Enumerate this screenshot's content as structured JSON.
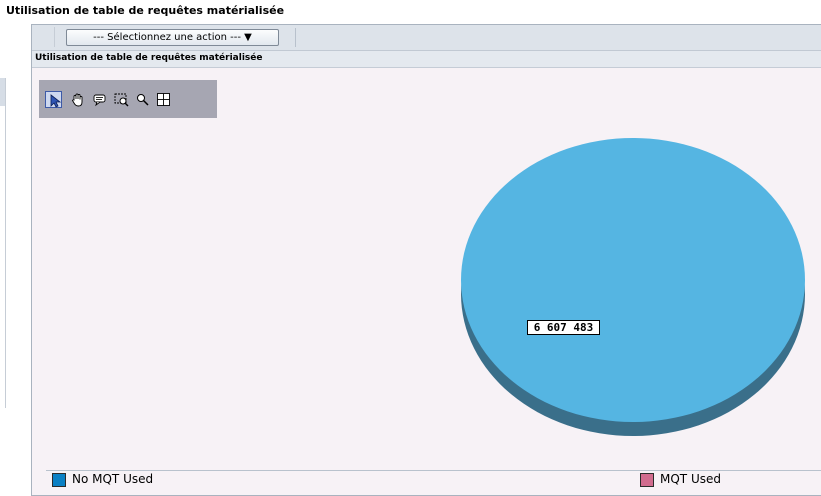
{
  "page": {
    "title": "Utilisation de table de requêtes matérialisée"
  },
  "toolbar": {
    "action_select": "--- Sélectionnez une action --- ▼"
  },
  "report": {
    "subtitle": "Utilisation de table de requêtes matérialisée"
  },
  "tools": {
    "select": "arrow-pointer-icon",
    "pan": "hand-pan-icon",
    "tooltip": "speech-bubble-icon",
    "zoom_area": "zoom-rectangle-icon",
    "zoom": "magnifier-icon",
    "reset": "crosshair-frame-icon"
  },
  "chart_data": {
    "type": "pie",
    "categories": [
      "No MQT Used",
      "MQT Used"
    ],
    "values": [
      6607483,
      0
    ],
    "data_labels": [
      "6 607 483"
    ],
    "colors": [
      "#55b5e2",
      "#d16b8e"
    ],
    "legend_position": "bottom"
  },
  "legend": {
    "items": [
      {
        "label": "No MQT Used"
      },
      {
        "label": "MQT Used"
      }
    ]
  },
  "colors": {
    "slice_side": "#3a6f8a",
    "background": "#f7f2f6",
    "toolbar": "#dde3ea"
  }
}
